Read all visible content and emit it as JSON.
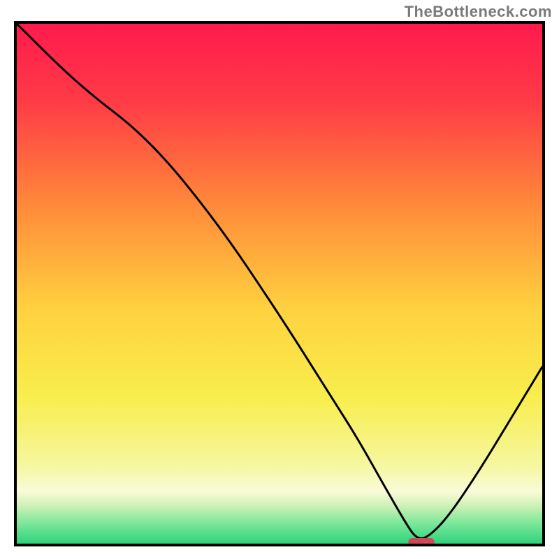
{
  "watermark": "TheBottleneck.com",
  "chart_data": {
    "type": "line",
    "title": "",
    "xlabel": "",
    "ylabel": "",
    "xlim": [
      0,
      100
    ],
    "ylim": [
      0,
      100
    ],
    "grid": false,
    "legend": false,
    "annotations": [],
    "background": {
      "gradient_stops": [
        {
          "pos": 0.0,
          "color": "#ff1a4d"
        },
        {
          "pos": 0.15,
          "color": "#ff3b46"
        },
        {
          "pos": 0.35,
          "color": "#ff8a3a"
        },
        {
          "pos": 0.55,
          "color": "#ffd23f"
        },
        {
          "pos": 0.72,
          "color": "#f8ee4d"
        },
        {
          "pos": 0.85,
          "color": "#f6f7a0"
        },
        {
          "pos": 0.9,
          "color": "#f9fbd8"
        },
        {
          "pos": 0.93,
          "color": "#c8f0b4"
        },
        {
          "pos": 0.96,
          "color": "#7de89a"
        },
        {
          "pos": 1.0,
          "color": "#2fd27a"
        }
      ]
    },
    "series": [
      {
        "name": "bottleneck-curve",
        "x": [
          0,
          12,
          25,
          38,
          50,
          60,
          65,
          70,
          74,
          76,
          78,
          82,
          88,
          94,
          100
        ],
        "y": [
          100,
          88,
          78,
          62,
          44,
          28,
          20,
          11,
          4,
          1,
          1,
          5,
          14,
          24,
          34
        ]
      }
    ],
    "marker": {
      "name": "optimal-point",
      "x": 77,
      "y": 0,
      "width_pct": 5,
      "height_pct": 1.6,
      "color": "#cc4a56"
    }
  }
}
